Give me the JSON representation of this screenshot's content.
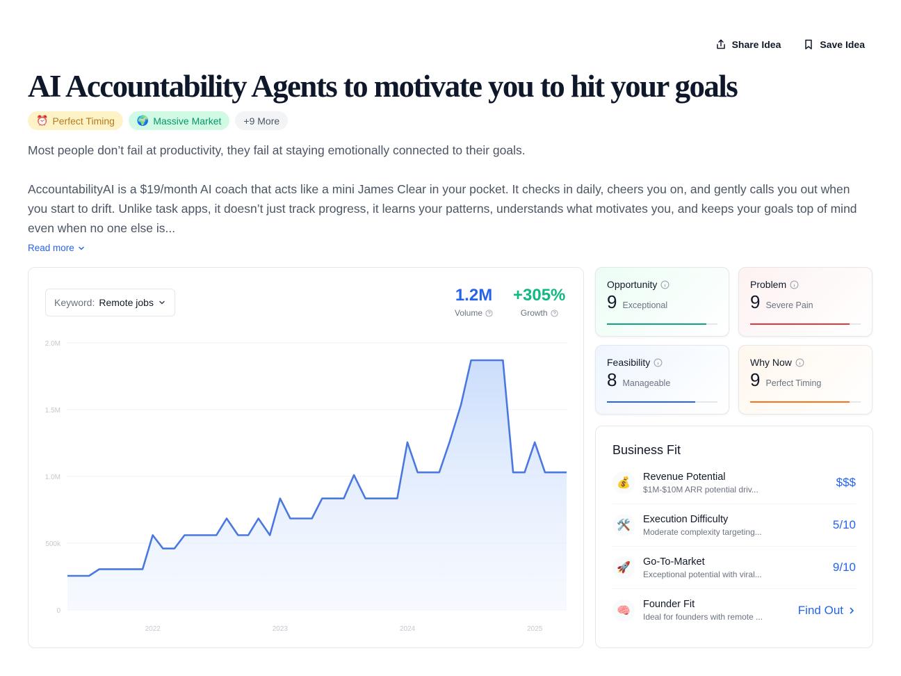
{
  "actions": {
    "share_label": "Share Idea",
    "save_label": "Save Idea"
  },
  "title": "AI Accountability Agents to motivate you to hit your goals",
  "badges": [
    {
      "emoji": "⏰",
      "label": "Perfect Timing"
    },
    {
      "emoji": "🌍",
      "label": "Massive Market"
    },
    {
      "label": "+9 More"
    }
  ],
  "summary": {
    "p1": "Most people don’t fail at productivity, they fail at staying emotionally connected to their goals.",
    "p2": "AccountabilityAI is a $19/month AI coach that acts like a mini James Clear in your pocket. It checks in daily, cheers you on, and gently calls you out when you start to drift. Unlike task apps, it doesn’t just track progress, it learns your patterns, understands what motivates you, and keeps your goals top of mind even when no one else is...",
    "read_more": "Read more"
  },
  "trend": {
    "keyword_label": "Keyword:",
    "keyword_value": "Remote jobs",
    "volume": "1.2M",
    "volume_label": "Volume",
    "growth": "+305%",
    "growth_label": "Growth"
  },
  "chart_data": {
    "type": "area",
    "y_ticks": [
      "0",
      "500k",
      "1.0M",
      "1.5M",
      "2.0M"
    ],
    "ylim": [
      0,
      2000000
    ],
    "x_ticks": [
      "2022",
      "2023",
      "2024",
      "2025"
    ],
    "x_tick_years": [
      2022,
      2023,
      2024,
      2025
    ],
    "xlim": [
      2021.33,
      2025.25
    ],
    "line_color": "#4a78e0",
    "series": [
      {
        "points": [
          [
            2021.33,
            255000
          ],
          [
            2021.5,
            255000
          ],
          [
            2021.58,
            305000
          ],
          [
            2021.92,
            305000
          ],
          [
            2022.0,
            560000
          ],
          [
            2022.08,
            460000
          ],
          [
            2022.17,
            460000
          ],
          [
            2022.25,
            560000
          ],
          [
            2022.5,
            560000
          ],
          [
            2022.58,
            685000
          ],
          [
            2022.67,
            560000
          ],
          [
            2022.75,
            560000
          ],
          [
            2022.83,
            685000
          ],
          [
            2022.92,
            560000
          ],
          [
            2023.0,
            835000
          ],
          [
            2023.08,
            685000
          ],
          [
            2023.25,
            685000
          ],
          [
            2023.33,
            835000
          ],
          [
            2023.5,
            835000
          ],
          [
            2023.58,
            1010000
          ],
          [
            2023.67,
            835000
          ],
          [
            2023.92,
            835000
          ],
          [
            2024.0,
            1255000
          ],
          [
            2024.08,
            1030000
          ],
          [
            2024.25,
            1030000
          ],
          [
            2024.33,
            1255000
          ],
          [
            2024.42,
            1535000
          ],
          [
            2024.5,
            1870000
          ],
          [
            2024.75,
            1870000
          ],
          [
            2024.83,
            1030000
          ],
          [
            2024.92,
            1030000
          ],
          [
            2025.0,
            1255000
          ],
          [
            2025.08,
            1030000
          ],
          [
            2025.25,
            1030000
          ]
        ]
      }
    ]
  },
  "scores": [
    {
      "name": "Opportunity",
      "value": "9",
      "desc": "Exceptional",
      "fraction": 0.9,
      "color": "#10a37f",
      "bg": "#ecfdf5"
    },
    {
      "name": "Problem",
      "value": "9",
      "desc": "Severe Pain",
      "fraction": 0.9,
      "color": "#e0383e",
      "bg": "#fef2f2"
    },
    {
      "name": "Feasibility",
      "value": "8",
      "desc": "Manageable",
      "fraction": 0.8,
      "color": "#2563eb",
      "bg": "#eff6ff"
    },
    {
      "name": "Why Now",
      "value": "9",
      "desc": "Perfect Timing",
      "fraction": 0.9,
      "color": "#f97316",
      "bg": "#fff7ed"
    }
  ],
  "business_fit": {
    "title": "Business Fit",
    "rows": [
      {
        "icon": "💰",
        "name": "Revenue Potential",
        "desc": "$1M-$10M ARR potential driv...",
        "value": "$$$"
      },
      {
        "icon": "🛠️",
        "name": "Execution Difficulty",
        "desc": "Moderate complexity targeting...",
        "value": "5/10"
      },
      {
        "icon": "🚀",
        "name": "Go-To-Market",
        "desc": "Exceptional potential with viral...",
        "value": "9/10"
      },
      {
        "icon": "🧠",
        "name": "Founder Fit",
        "desc": "Ideal for founders with remote ...",
        "value": "Find Out"
      }
    ]
  }
}
